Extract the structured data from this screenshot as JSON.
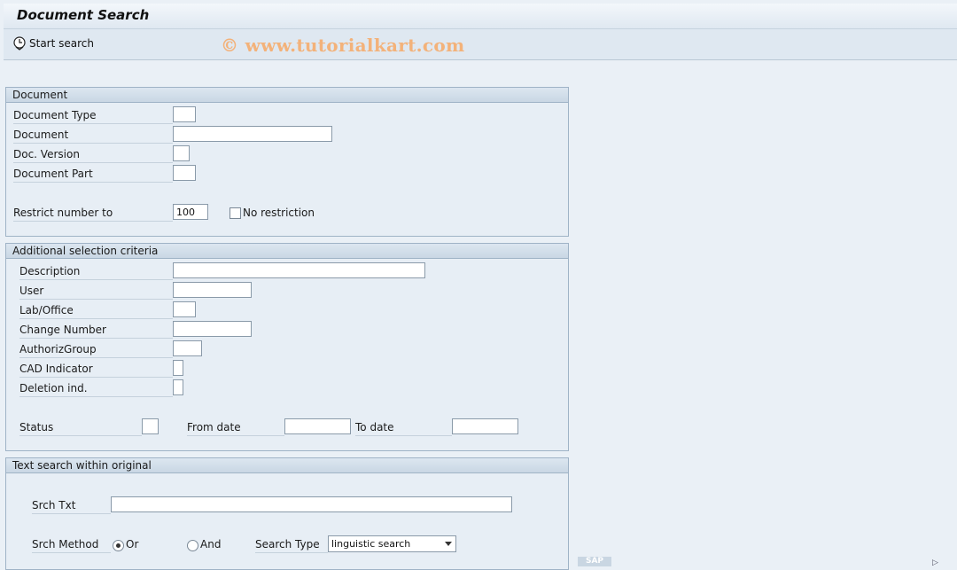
{
  "window": {
    "title": "Document Search"
  },
  "toolbar": {
    "start_search": "Start search",
    "watermark": "© www.tutorialkart.com"
  },
  "document_group": {
    "title": "Document",
    "document_type": "Document Type",
    "document": "Document",
    "doc_version": "Doc. Version",
    "document_part": "Document Part",
    "restrict_label": "Restrict number to",
    "restrict_value": "100",
    "no_restriction": "No restriction"
  },
  "additional_group": {
    "title": "Additional selection criteria",
    "description": "Description",
    "user": "User",
    "lab_office": "Lab/Office",
    "change_number": "Change Number",
    "authoriz_group": "AuthorizGroup",
    "cad_indicator": "CAD Indicator",
    "deletion_ind": "Deletion ind.",
    "status": "Status",
    "from_date": "From date",
    "to_date": "To date"
  },
  "text_search_group": {
    "title": "Text search within original",
    "srch_txt": "Srch Txt",
    "srch_method": "Srch Method",
    "or": "Or",
    "and": "And",
    "search_type": "Search Type",
    "search_type_value": "linguistic search",
    "selected_method": "Or"
  },
  "footer": {
    "sap_logo": "SAP"
  }
}
